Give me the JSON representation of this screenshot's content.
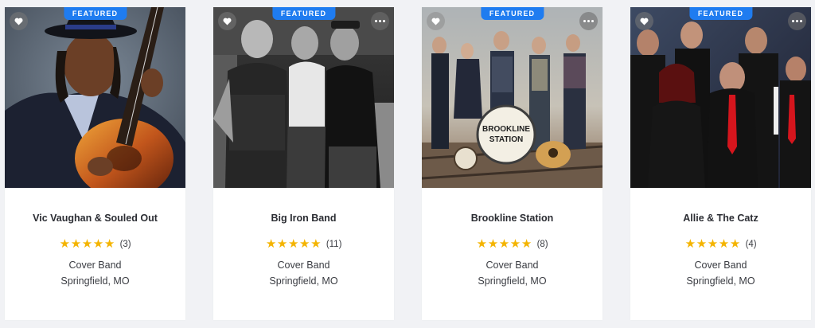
{
  "badge_label": "FEATURED",
  "accent_color": "#1f7cf0",
  "star_color": "#f4b400",
  "cards": [
    {
      "name": "Vic Vaughan & Souled Out",
      "rating_stars": 5,
      "review_count": "(3)",
      "category": "Cover Band",
      "location": "Springfield, MO",
      "photo_description": "guitarist-in-hat-portrait"
    },
    {
      "name": "Big Iron Band",
      "rating_stars": 5,
      "review_count": "(11)",
      "category": "Cover Band",
      "location": "Springfield, MO",
      "photo_description": "three-men-black-and-white"
    },
    {
      "name": "Brookline Station",
      "rating_stars": 5,
      "review_count": "(8)",
      "category": "Cover Band",
      "location": "Springfield, MO",
      "photo_description": "band-on-railroad-tracks",
      "drum_logo_text_1": "BROOKLINE",
      "drum_logo_text_2": "STATION"
    },
    {
      "name": "Allie & The Catz",
      "rating_stars": 5,
      "review_count": "(4)",
      "category": "Cover Band",
      "location": "Springfield, MO",
      "photo_description": "band-in-black-with-red-ties"
    }
  ]
}
